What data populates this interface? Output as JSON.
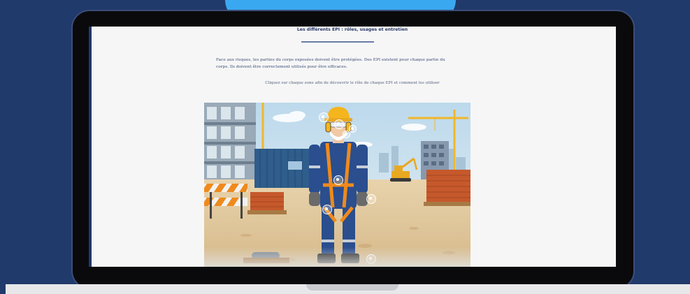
{
  "page": {
    "title": "Les différents EPI : rôles, usages et entretien",
    "intro_1": "Face aux risques, les parties du corps exposées doivent être protégées. Des EPI existent pour chaque partie du",
    "intro_2": "corps. Ils doivent être correctement utilisés pour être efficaces.",
    "instruction": "Cliquez sur chaque zone afin de découvrir le rôle de chaque EPI et comment les utiliser"
  },
  "scene": {
    "icons": [
      "construction-worker",
      "crane",
      "excavator",
      "site-cabin",
      "brick-pallet",
      "road-barrier",
      "hotspot-plus"
    ]
  },
  "colors": {
    "background": "#203a6b",
    "accent_blob": "#3aa8f0",
    "worker_suit": "#2a4e8e",
    "harness": "#ef8a1c",
    "helmet": "#f4b51d"
  }
}
